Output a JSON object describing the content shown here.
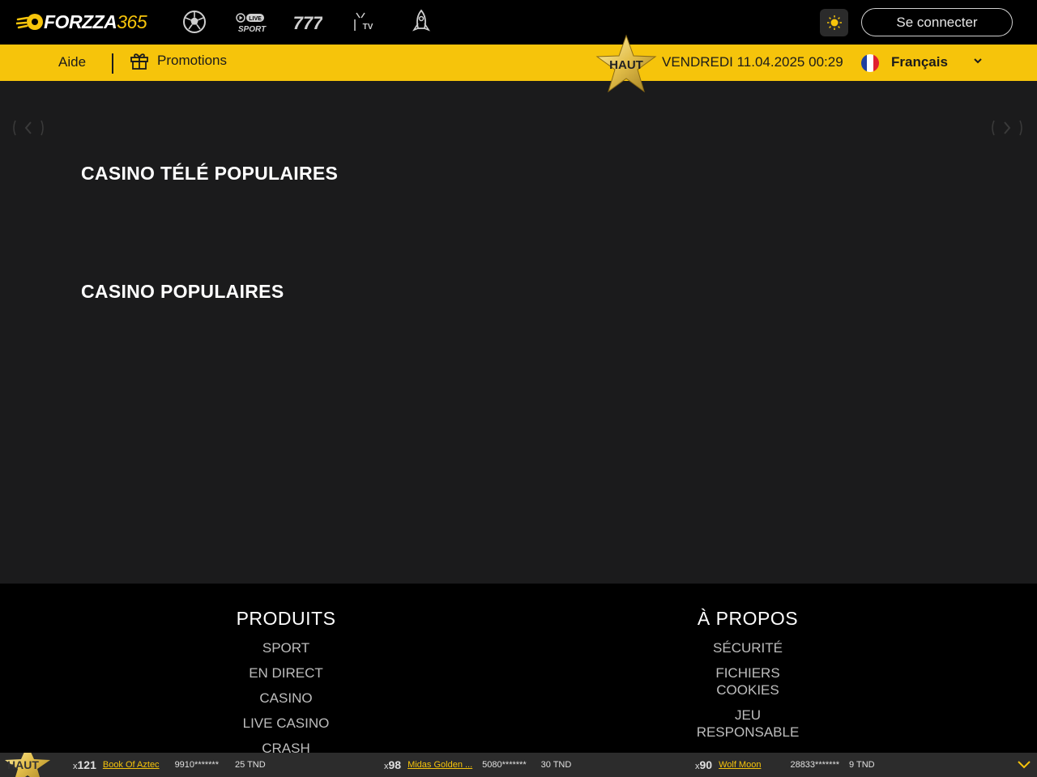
{
  "header": {
    "logo_word": "FORZZA",
    "logo_num": "365",
    "nav_icons": [
      {
        "name": "football-icon"
      },
      {
        "name": "live-sport-icon",
        "badge": "LIVE",
        "label": "SPORT"
      },
      {
        "name": "slots-777-icon"
      },
      {
        "name": "tv-icon",
        "label": "TV"
      },
      {
        "name": "rocket-icon"
      }
    ],
    "theme_icon": "sun-icon",
    "login_label": "Se connecter"
  },
  "subbar": {
    "help_label": "Aide",
    "promo_label": "Promotions",
    "top_label": "HAUT",
    "datetime": "VENDREDI 11.04.2025 00:29",
    "language": "Français"
  },
  "main": {
    "section1": "CASINO TÉLÉ POPULAIRES",
    "section2": "CASINO POPULAIRES"
  },
  "footer": {
    "products": {
      "title": "PRODUITS",
      "links": [
        "SPORT",
        "EN DIRECT",
        "CASINO",
        "LIVE CASINO",
        "CRASH"
      ]
    },
    "about": {
      "title": "À PROPOS",
      "links": [
        "SÉCURITÉ",
        "FICHIERS COOKIES",
        "JEU RESPONSABLE"
      ]
    }
  },
  "ticker": {
    "top_label": "HAUT",
    "wins": [
      {
        "x": "x",
        "mult": "121",
        "game": "Book Of Aztec",
        "user": "9910*******",
        "amount": "25 TND"
      },
      {
        "x": "x",
        "mult": "98",
        "game": "Midas Golden ...",
        "user": "5080*******",
        "amount": "30 TND"
      },
      {
        "x": "x",
        "mult": "90",
        "game": "Wolf Moon",
        "user": "28833*******",
        "amount": "9 TND"
      }
    ]
  },
  "colors": {
    "accent": "#f6c40b",
    "background": "#1b1b1c",
    "header": "#000000"
  }
}
